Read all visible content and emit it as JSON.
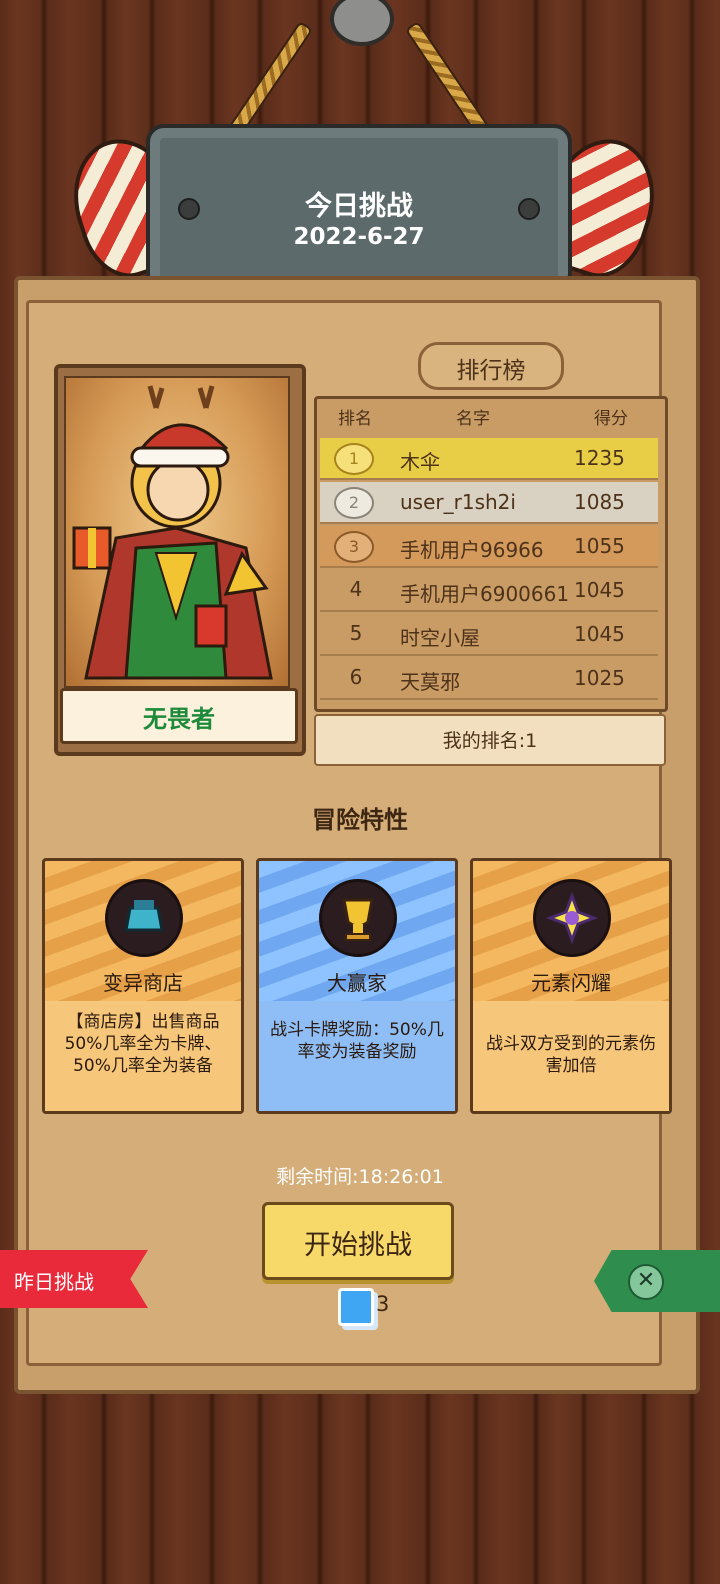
{
  "header": {
    "title": "今日挑战",
    "date": "2022-6-27"
  },
  "hero": {
    "name": "无畏者"
  },
  "leaderboard": {
    "title": "排行榜",
    "columns": [
      "排名",
      "名字",
      "得分"
    ],
    "rows": [
      {
        "rank": "1",
        "name": "木伞",
        "score": "1235",
        "highlight": "#e8cd47"
      },
      {
        "rank": "2",
        "name": "user_r1sh2i",
        "score": "1085",
        "highlight": "#d9d1c1"
      },
      {
        "rank": "3",
        "name": "手机用户96966",
        "score": "1055",
        "highlight": "#d39a5c"
      },
      {
        "rank": "4",
        "name": "手机用户6900661",
        "score": "1045",
        "highlight": ""
      },
      {
        "rank": "5",
        "name": "时空小屋",
        "score": "1045",
        "highlight": ""
      },
      {
        "rank": "6",
        "name": "天莫邪",
        "score": "1025",
        "highlight": ""
      }
    ],
    "my_rank": "我的排名:1"
  },
  "traits": {
    "title": "冒险特性",
    "cards": [
      {
        "name": "变异商店",
        "desc": "【商店房】出售商品50%几率全为卡牌、50%几率全为装备",
        "icon": "mutant-shop-icon"
      },
      {
        "name": "大赢家",
        "desc": "战斗卡牌奖励：50%几率变为装备奖励",
        "icon": "trophy-icon"
      },
      {
        "name": "元素闪耀",
        "desc": "战斗双方受到的元素伤害加倍",
        "icon": "element-burst-icon"
      }
    ]
  },
  "footer": {
    "timer": "剩余时间:18:26:01",
    "start_label": "开始挑战",
    "ticket_count": "3",
    "yesterday_label": "昨日挑战",
    "close_symbol": "✕"
  }
}
